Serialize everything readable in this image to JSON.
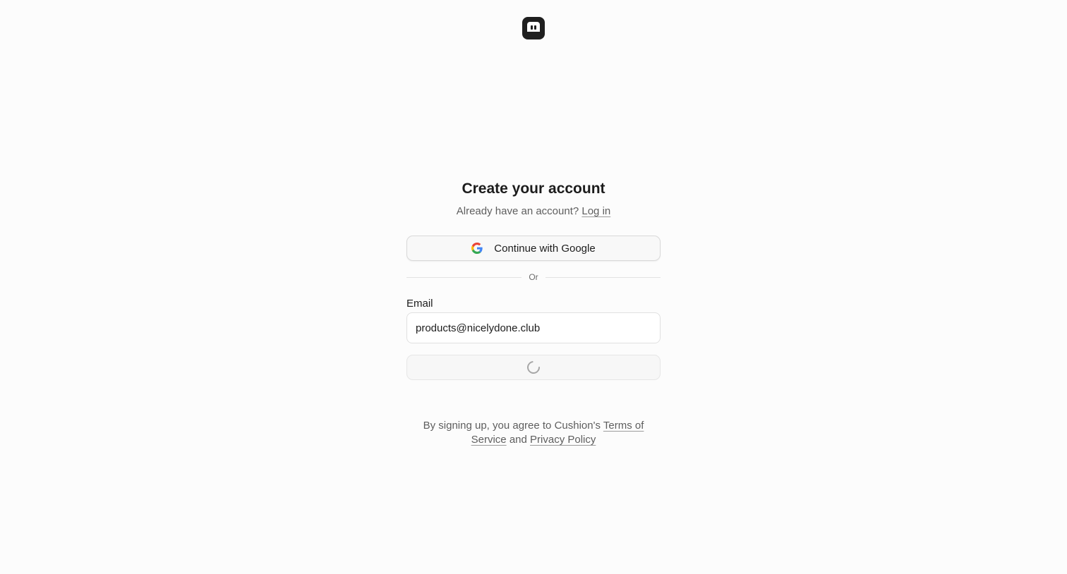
{
  "logo": {
    "icon": "cushion-logo-icon"
  },
  "heading": "Create your account",
  "login_prompt": {
    "text": "Already have an account?",
    "link": "Log in"
  },
  "google_button": {
    "icon": "google-icon",
    "label": "Continue with Google"
  },
  "divider": {
    "label": "Or"
  },
  "email": {
    "label": "Email",
    "value": "products@nicelydone.club"
  },
  "submit_button": {
    "state": "loading",
    "icon": "spinner-icon"
  },
  "terms": {
    "prefix": "By signing up, you agree to Cushion's",
    "terms_link": "Terms of Service",
    "conjunction": "and",
    "privacy_link": "Privacy Policy"
  },
  "colors": {
    "background": "#fcfcfc",
    "text": "#1f1f1f",
    "muted_text": "#5e5e5e",
    "border": "#e0e0e0"
  }
}
